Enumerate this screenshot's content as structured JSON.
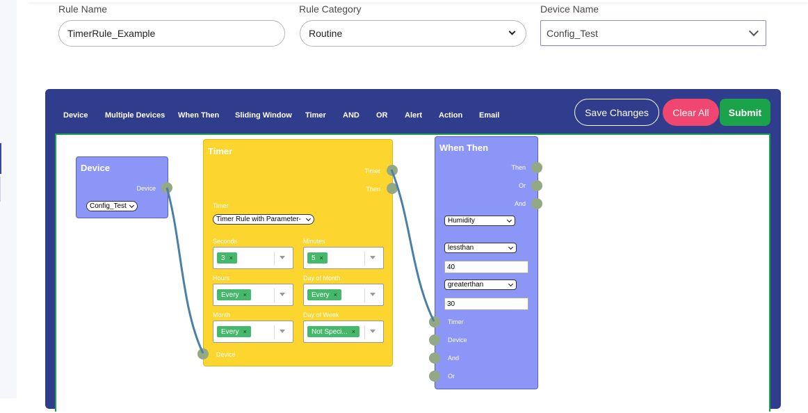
{
  "form": {
    "rule_name_label": "Rule Name",
    "rule_name_value": "TimerRule_Example",
    "rule_category_label": "Rule Category",
    "rule_category_value": "Routine",
    "device_name_label": "Device Name",
    "device_name_value": "Config_Test"
  },
  "toolbar": {
    "items": [
      "Device",
      "Multiple Devices",
      "When Then",
      "Sliding Window",
      "Timer",
      "AND",
      "OR",
      "Alert",
      "Action",
      "Email"
    ],
    "save_label": "Save Changes",
    "clear_label": "Clear All",
    "submit_label": "Submit"
  },
  "nodes": {
    "device": {
      "title": "Device",
      "port_label": "Device",
      "select_value": "Config_Test"
    },
    "timer": {
      "title": "Timer",
      "out_ports": [
        "Timer",
        "Then"
      ],
      "timer_label": "Timer",
      "timer_select": "Timer Rule with Parameter-",
      "fields": [
        {
          "label": "Seconds",
          "chip": "3"
        },
        {
          "label": "Minutes",
          "chip": "5"
        },
        {
          "label": "Hours",
          "chip": "Every"
        },
        {
          "label": "Day of Month",
          "chip": "Every"
        },
        {
          "label": "Month",
          "chip": "Every"
        },
        {
          "label": "Day of Week",
          "chip": "Not Speci..."
        }
      ],
      "chip_remove": "×",
      "in_port": "Device"
    },
    "when_then": {
      "title": "When Then",
      "out_ports": [
        "Then",
        "Or",
        "And"
      ],
      "sensor_select": "Humidity",
      "cond1_select": "lessthan",
      "cond1_value": "40",
      "cond2_select": "greaterthan",
      "cond2_value": "30",
      "in_ports": [
        "Timer",
        "Device",
        "And",
        "Or"
      ]
    }
  },
  "colors": {
    "builder_bg": "#2f3d8c",
    "canvas_border": "#1aa34a",
    "device_node": "#8c96f6",
    "timer_node": "#fcd52e",
    "port": "#93a985",
    "wire": "#4a7fa8",
    "chip": "#45b86b",
    "clear_button": "#f0466f",
    "submit_button": "#1aa34a"
  }
}
